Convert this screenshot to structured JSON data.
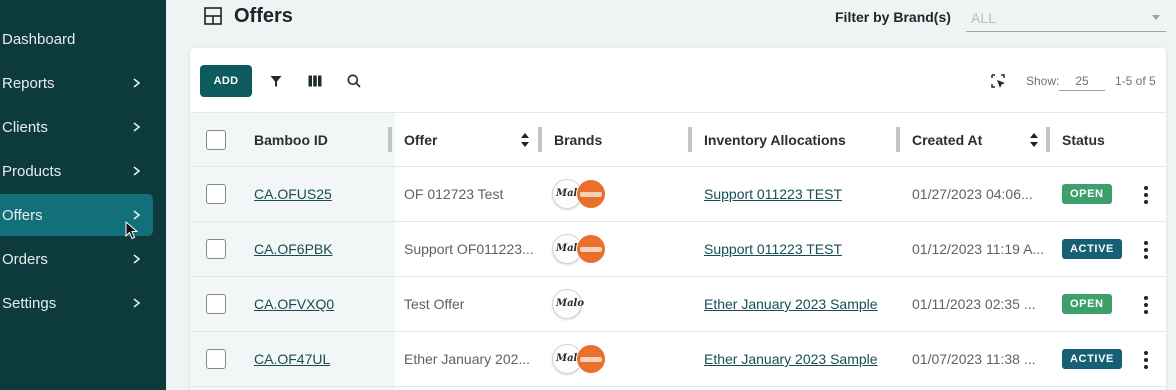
{
  "sidebar": {
    "items": [
      {
        "label": "Dashboard",
        "has_chevron": false,
        "active": false
      },
      {
        "label": "Reports",
        "has_chevron": true,
        "active": false
      },
      {
        "label": "Clients",
        "has_chevron": true,
        "active": false
      },
      {
        "label": "Products",
        "has_chevron": true,
        "active": false
      },
      {
        "label": "Offers",
        "has_chevron": true,
        "active": true
      },
      {
        "label": "Orders",
        "has_chevron": true,
        "active": false
      },
      {
        "label": "Settings",
        "has_chevron": true,
        "active": false
      }
    ]
  },
  "header": {
    "title": "Offers",
    "filter_label": "Filter by Brand(s)",
    "filter_value": "ALL"
  },
  "toolbar": {
    "add_label": "ADD",
    "show_label": "Show:",
    "page_size": "25",
    "range_text": "1-5 of 5"
  },
  "table": {
    "columns": [
      "Bamboo ID",
      "Offer",
      "Brands",
      "Inventory Allocations",
      "Created At",
      "Status"
    ],
    "rows": [
      {
        "id": "CA.OFUS25",
        "offer": "OF 012723 Test",
        "brands": "two",
        "allocation": "Support 011223 TEST",
        "created": "01/27/2023 04:06...",
        "status": "OPEN"
      },
      {
        "id": "CA.OF6PBK",
        "offer": "Support OF011223...",
        "brands": "two",
        "allocation": "Support 011223 TEST",
        "created": "01/12/2023 11:19 A...",
        "status": "ACTIVE"
      },
      {
        "id": "CA.OFVXQ0",
        "offer": "Test Offer",
        "brands": "one",
        "allocation": "Ether January 2023 Sample",
        "created": "01/11/2023 02:35 ...",
        "status": "OPEN"
      },
      {
        "id": "CA.OF47UL",
        "offer": "Ether January 202...",
        "brands": "two",
        "allocation": "Ether January 2023 Sample",
        "created": "01/07/2023 11:38 ...",
        "status": "ACTIVE"
      }
    ]
  },
  "colors": {
    "sidebar_bg": "#0d3a3c",
    "sidebar_active": "#13707a",
    "primary": "#0d5a5f",
    "status_open": "#3d9f6b",
    "status_active": "#165f74"
  }
}
